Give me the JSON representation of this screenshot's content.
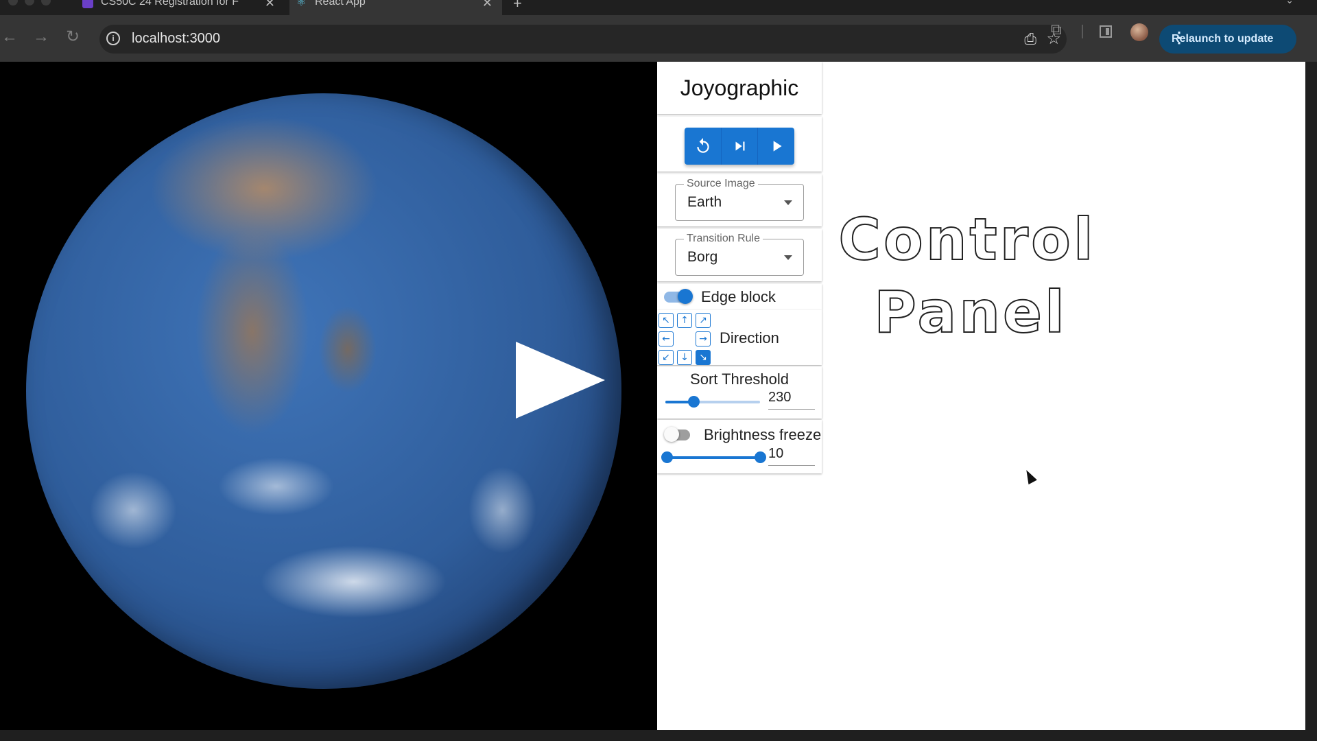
{
  "browser": {
    "tabs": [
      {
        "title": "CS50C 24 Registration for F",
        "active": false,
        "favicon_color": "#6a3fc7"
      },
      {
        "title": "React App",
        "active": true,
        "favicon_color": "#61dafb"
      }
    ],
    "url": "localhost:3000",
    "relaunch_label": "Relaunch to update",
    "accent": "#0d4a74"
  },
  "canvas": {
    "image": "earth",
    "overlay_icon": "play-icon"
  },
  "panel": {
    "title": "Joyographic",
    "controls": {
      "reset_icon": "reset-icon",
      "step_icon": "skip-next-icon",
      "play_icon": "play-icon"
    },
    "source_image": {
      "label": "Source Image",
      "value": "Earth"
    },
    "transition_rule": {
      "label": "Transition Rule",
      "value": "Borg"
    },
    "edge_block": {
      "label": "Edge block",
      "enabled": true
    },
    "direction": {
      "label": "Direction",
      "cells": [
        "↖",
        "↑",
        "↗",
        "←",
        "",
        "→",
        "↙",
        "↓",
        "↘"
      ],
      "selected": 8
    },
    "sort_threshold": {
      "label": "Sort Threshold",
      "value": "230",
      "fraction": 0.3
    },
    "brightness_freeze": {
      "label": "Brightness freeze",
      "enabled": false,
      "value": "10",
      "range": [
        0,
        1
      ]
    }
  },
  "overlay_text": {
    "line1": "Control",
    "line2": "Panel"
  },
  "colors": {
    "primary": "#1976d2",
    "primary_light": "#90b8e6"
  }
}
